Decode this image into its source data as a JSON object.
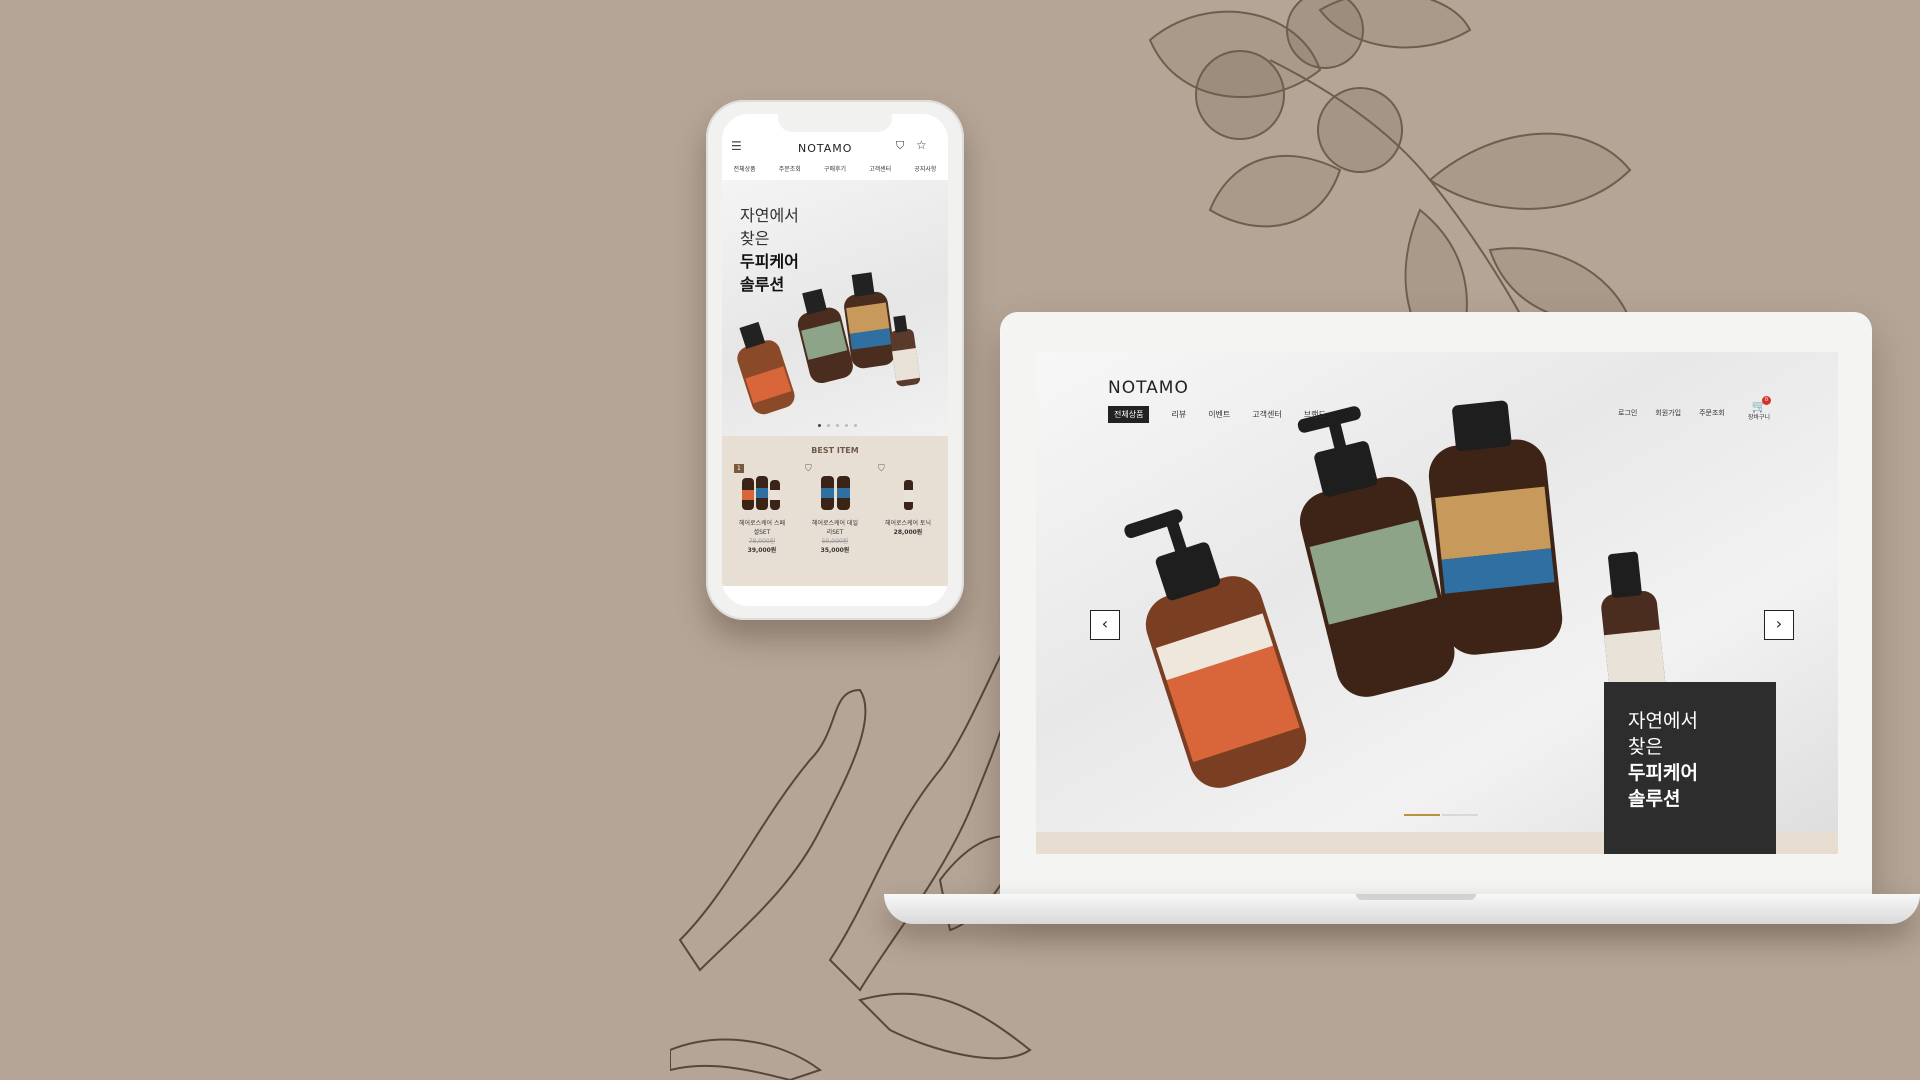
{
  "colors": {
    "background": "#b5a596",
    "best_bg": "#e8dfd4",
    "panel": "#2d2d2d",
    "accent_gold": "#b8933b",
    "badge_red": "#d9302b"
  },
  "mobile": {
    "logo": "NOTAMO",
    "menu_icon": "hamburger-icon",
    "nav": [
      "전체상품",
      "주문조회",
      "구매후기",
      "고객센터",
      "공지사항"
    ],
    "hero": {
      "line1": "자연에서",
      "line2": "찾은",
      "line3": "두피케어",
      "line4": "솔루션"
    },
    "best_title": "BEST ITEM",
    "products": [
      {
        "name1": "헤어로스케어 스페",
        "name2": "셜SET",
        "old_price": "78,000원",
        "price": "39,000원",
        "badge": "1"
      },
      {
        "name1": "헤어로스케어 데일",
        "name2": "리SET",
        "old_price": "50,000원",
        "price": "35,000원"
      },
      {
        "name1": "헤어로스케어 토닉",
        "name2": "",
        "old_price": "",
        "price": "28,000원"
      }
    ]
  },
  "desktop": {
    "logo": "NOTAMO",
    "nav": [
      "전체상품",
      "리뷰",
      "이벤트",
      "고객센터",
      "브랜드"
    ],
    "utility": [
      "로그인",
      "회원가입",
      "주문조회"
    ],
    "cart_label": "장바구니",
    "cart_count": "0",
    "hero": {
      "line1": "자연에서",
      "line2": "찾은",
      "line3": "두피케어",
      "line4": "솔루션"
    }
  }
}
